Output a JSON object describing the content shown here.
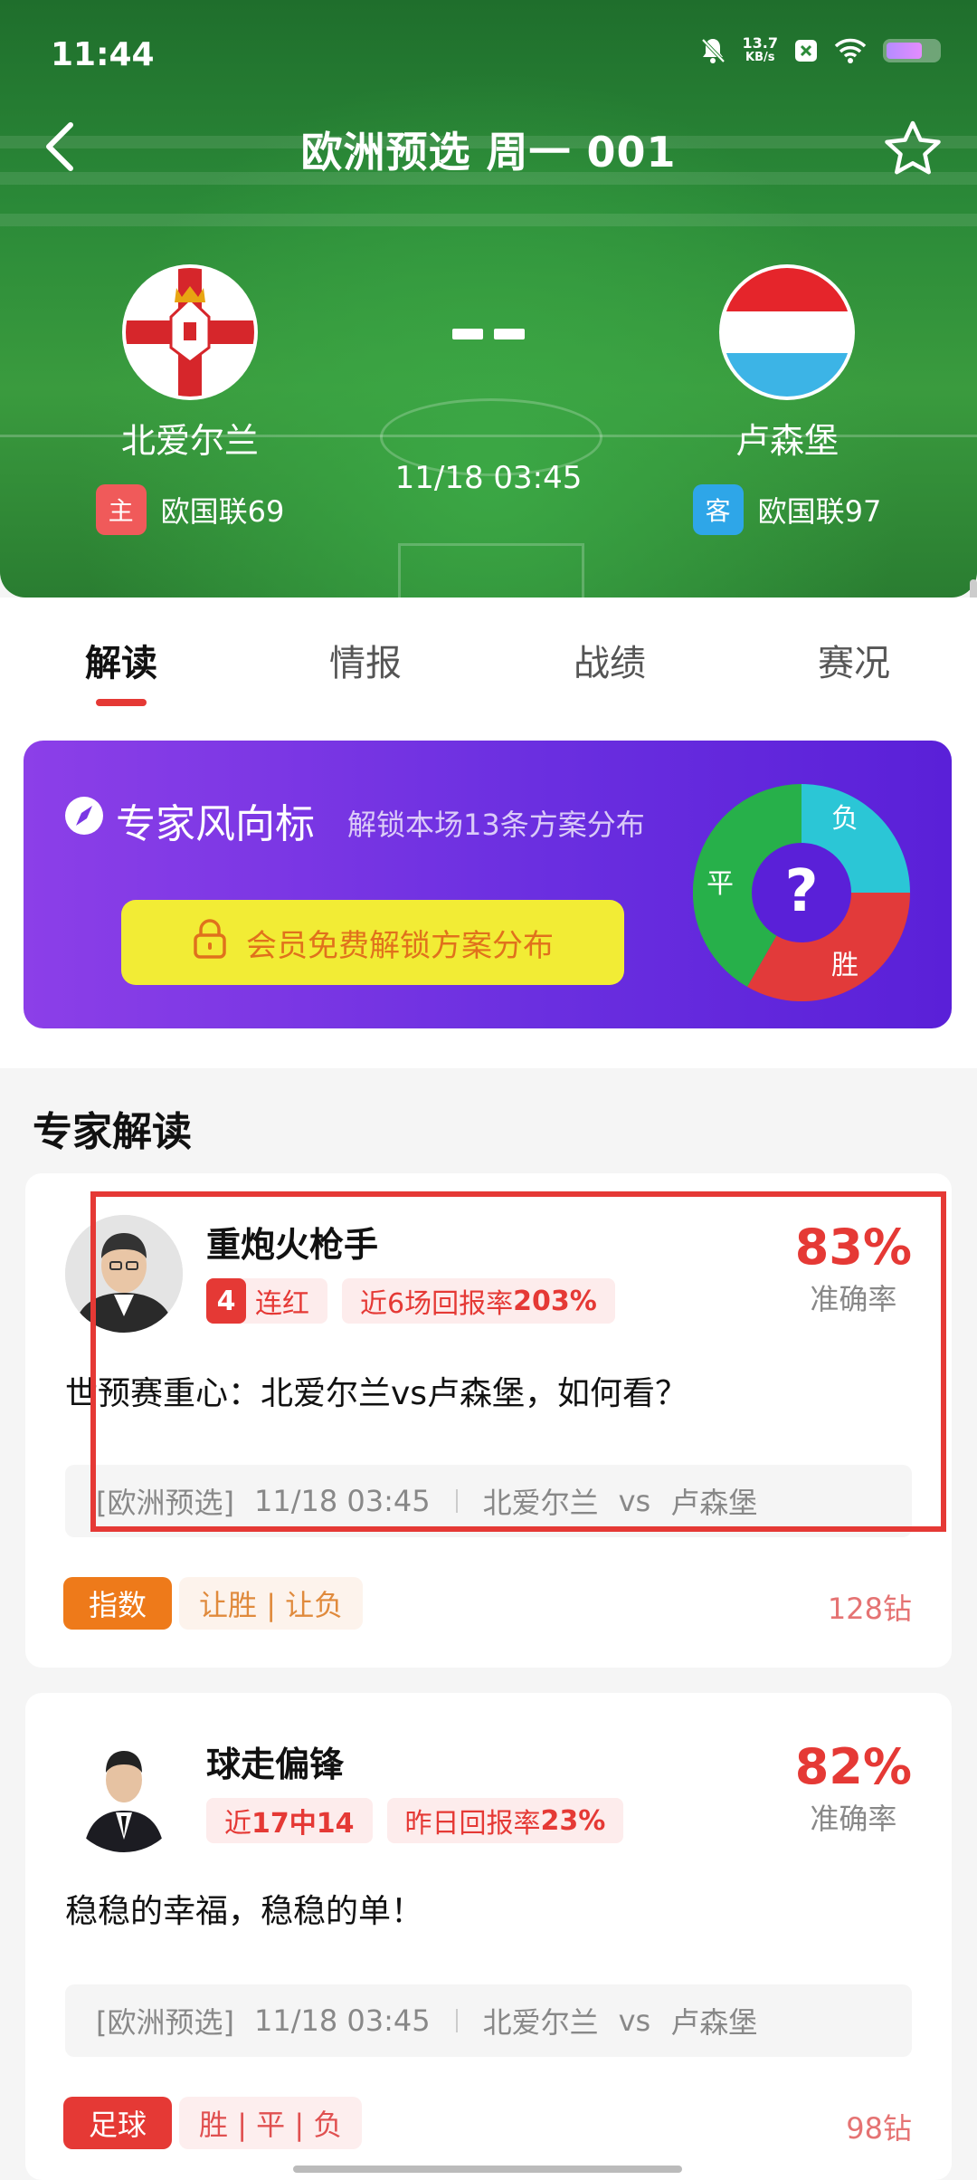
{
  "status_bar": {
    "time": "11:44",
    "net_speed_value": "13.7",
    "net_speed_unit": "KB/s",
    "battery_level": 0.7
  },
  "header": {
    "title": "欧洲预选 周一 001",
    "home": {
      "name": "北爱尔兰",
      "side_tag": "主",
      "league_rank": "欧国联69",
      "tag_color": "#f05a5a"
    },
    "away": {
      "name": "卢森堡",
      "side_tag": "客",
      "league_rank": "欧国联97",
      "tag_color": "#2ea6e8"
    },
    "kickoff": "11/18 03:45"
  },
  "tabs": [
    {
      "label": "解读",
      "active": true
    },
    {
      "label": "情报",
      "active": false
    },
    {
      "label": "战绩",
      "active": false
    },
    {
      "label": "赛况",
      "active": false
    }
  ],
  "promo": {
    "title": "专家风向标",
    "subtitle": "解锁本场13条方案分布",
    "button_label": "会员免费解锁方案分布",
    "donut": {
      "center": "?",
      "segments": [
        {
          "label": "负",
          "color": "#2bc6d6"
        },
        {
          "label": "胜",
          "color": "#e23a3a"
        },
        {
          "label": "平",
          "color": "#27b04a"
        }
      ]
    }
  },
  "section_title": "专家解读",
  "experts": [
    {
      "name": "重炮火枪手",
      "streak_num": "4",
      "streak_label": "连红",
      "stat_prefix": "近6场回报率",
      "stat_value": "203%",
      "accuracy": "83%",
      "accuracy_label": "准确率",
      "headline": "世预赛重心：北爱尔兰vs卢森堡，如何看？",
      "match_league": "[欧洲预选]",
      "match_time": "11/18 03:45",
      "match_home": "北爱尔兰",
      "match_vs": "vs",
      "match_away": "卢森堡",
      "type_badge": "指数",
      "type_color": "#ee7a1a",
      "plays": "让胜 | 让负",
      "price": "128钻"
    },
    {
      "name": "球走偏锋",
      "tag1_prefix": "近",
      "tag1_value": "17中14",
      "stat_prefix": "昨日回报率",
      "stat_value": "23%",
      "accuracy": "82%",
      "accuracy_label": "准确率",
      "headline": "稳稳的幸福，稳稳的单！",
      "match_league": "[欧洲预选]",
      "match_time": "11/18 03:45",
      "match_home": "北爱尔兰",
      "match_vs": "vs",
      "match_away": "卢森堡",
      "type_badge": "足球",
      "type_color": "#e53935",
      "plays": "胜 | 平 | 负",
      "price": "98钻"
    }
  ]
}
